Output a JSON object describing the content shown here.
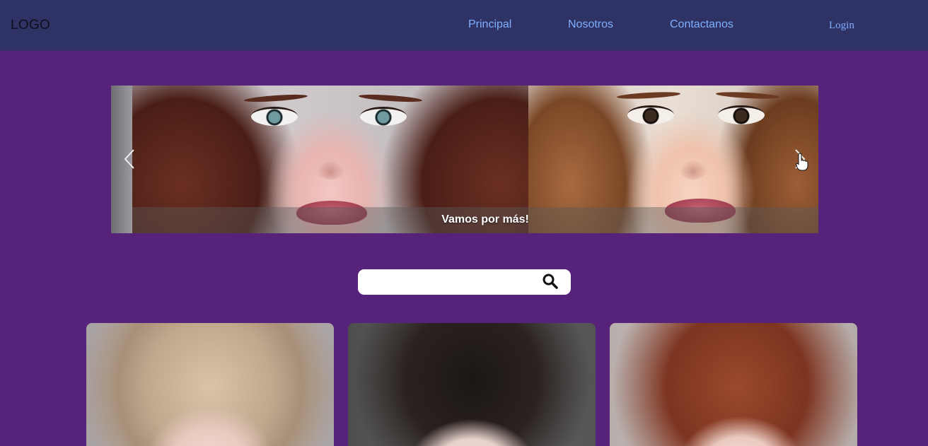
{
  "header": {
    "logo_text": "LOGO",
    "nav": [
      {
        "label": "Principal"
      },
      {
        "label": "Nosotros"
      },
      {
        "label": "Contactanos"
      }
    ],
    "login_label": "Login"
  },
  "carousel": {
    "caption": "Vamos por más!",
    "prev_icon": "chevron-left-icon",
    "next_icon": "chevron-right-icon"
  },
  "search": {
    "value": "",
    "placeholder": "",
    "icon": "search-icon"
  },
  "colors": {
    "page_background": "#57237a",
    "navbar_background": "#2e3264",
    "nav_link": "#7fb0ff"
  }
}
